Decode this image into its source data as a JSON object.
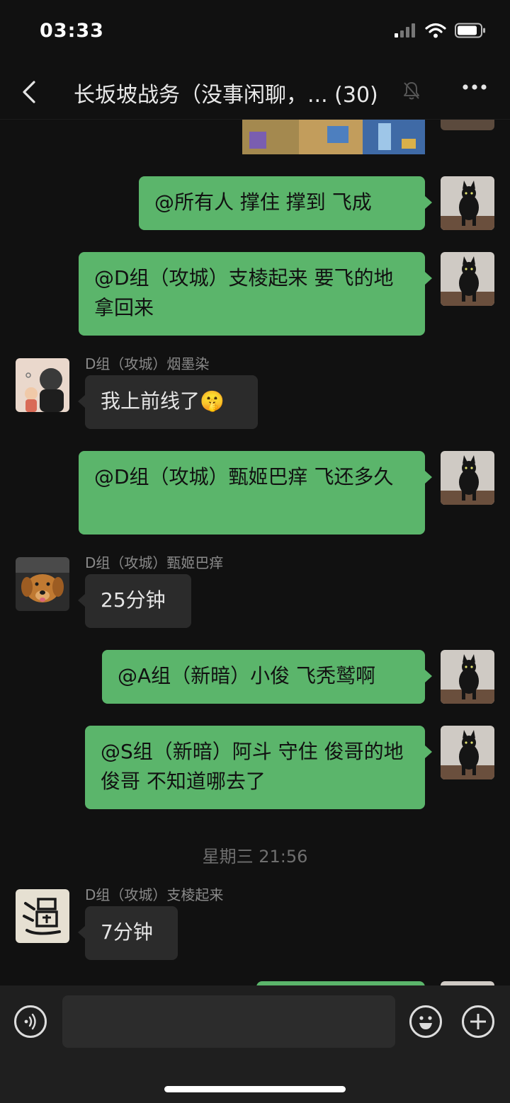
{
  "status": {
    "time": "03:33"
  },
  "header": {
    "title": "长坂坡战务（没事闲聊，...",
    "member_count": "(30)"
  },
  "messages": [
    {
      "text": "@所有人 撑住  撑到  飞成"
    },
    {
      "text": "@D组（攻城）支棱起来 要飞的地 拿回来"
    },
    {
      "sender": "D组（攻城）烟墨染",
      "text": "我上前线了🤫"
    },
    {
      "text": "@D组（攻城）甄姬巴痒 飞还多久"
    },
    {
      "sender": "D组（攻城）甄姬巴痒",
      "text": "25分钟"
    },
    {
      "text": "@A组（新暗）小俊 飞秃鹫啊"
    },
    {
      "text": "@S组（新暗）阿斗 守住   俊哥的地  俊哥 不知道哪去了"
    },
    {
      "sender": "D组（攻城）支棱起来",
      "text": "7分钟"
    }
  ],
  "separator": {
    "timestamp": "星期三 21:56"
  },
  "composer": {
    "value": "",
    "placeholder": ""
  },
  "icons": {
    "back": "chevron-left-icon",
    "mute": "bell-slash-icon",
    "more": "more-icon",
    "voice": "voice-icon",
    "emoji": "emoji-icon",
    "plus": "plus-icon"
  },
  "colors": {
    "bubble_out": "#5bb56b",
    "bubble_in": "#2b2b2b",
    "background": "#111111"
  }
}
